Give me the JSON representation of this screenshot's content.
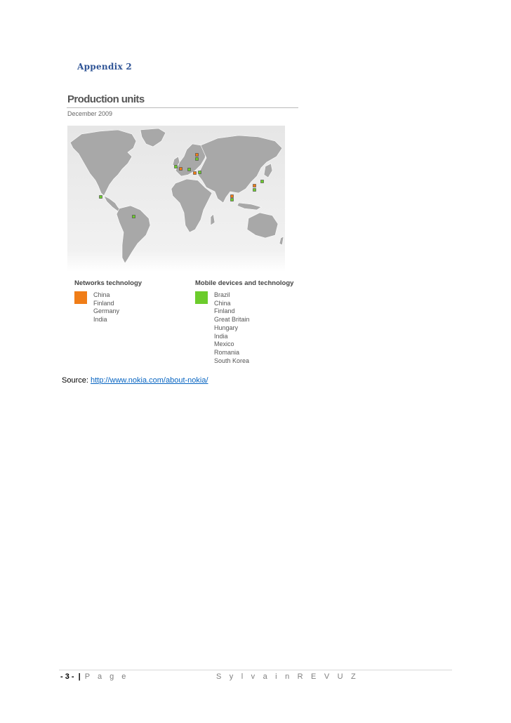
{
  "appendix_heading": "Appendix 2",
  "figure": {
    "title": "Production units",
    "date": "December 2009",
    "colors": {
      "networks": "#f07d17",
      "mobile": "#6ccc2c",
      "land": "#a8a8a8",
      "ocean": "#ededed"
    },
    "legend": {
      "networks": {
        "title": "Networks technology",
        "items": [
          "China",
          "Finland",
          "Germany",
          "India"
        ]
      },
      "mobile": {
        "title": "Mobile devices and technology",
        "items": [
          "Brazil",
          "China",
          "Finland",
          "Great Britain",
          "Hungary",
          "India",
          "Mexico",
          "Romania",
          "South Korea"
        ]
      }
    }
  },
  "source": {
    "label": "Source:",
    "url_text": "http://www.nokia.com/about-nokia/"
  },
  "footer": {
    "page_number": "- 3 -",
    "separator": "|",
    "page_label": "P a g e",
    "author": "S y l v a i n   R E V U Z"
  }
}
